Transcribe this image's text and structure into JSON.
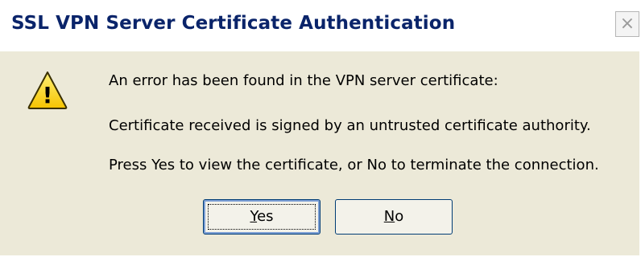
{
  "window": {
    "title": "SSL VPN Server Certificate Authentication",
    "close_symbol": "×"
  },
  "icon": {
    "name": "warning-icon",
    "fill_color": "#ffd800",
    "outline_color": "#3a3000",
    "glyph": "!"
  },
  "message": {
    "line1": "An error has been found in the VPN server certificate:",
    "line2": "Certificate received is signed by an untrusted certificate authority.",
    "line3": "Press Yes to view the certificate, or No to terminate the connection."
  },
  "buttons": {
    "yes": {
      "mnemonic": "Y",
      "rest": "es"
    },
    "no": {
      "mnemonic": "N",
      "rest": "o"
    }
  },
  "colors": {
    "dialog_bg": "#ece9d8",
    "title_color": "#0a246a",
    "button_border": "#003c74"
  }
}
